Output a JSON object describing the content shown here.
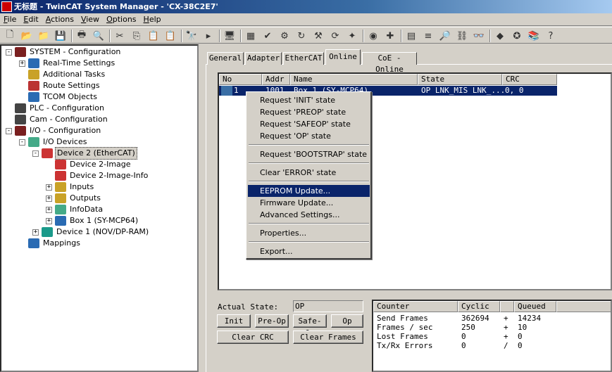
{
  "window": {
    "title": "无标题 - TwinCAT System Manager - 'CX-38C2E7'"
  },
  "menu": [
    "File",
    "Edit",
    "Actions",
    "View",
    "Options",
    "Help"
  ],
  "toolbar_icons": [
    "new-icon",
    "open-icon",
    "open-folder-icon",
    "save-icon",
    "print-icon",
    "print-preview-icon",
    "cut-icon",
    "copy-icon",
    "paste-icon",
    "paste-with-links-icon",
    "find-icon",
    "find-next-icon",
    "monitor-icon",
    "generate-mappings-icon",
    "check-icon",
    "activate-config-icon",
    "restart-run-icon",
    "config-mode-icon",
    "reload-devices-icon",
    "scan-icon",
    "toggle-freerun-icon",
    "show-online-icon",
    "add-icon",
    "variable-list-icon",
    "zoom-icon",
    "online-link-icon",
    "watch-icon",
    "go-icon",
    "force-icon",
    "books-icon",
    "help-icon"
  ],
  "tree": [
    {
      "label": "SYSTEM - Configuration",
      "icon": "system-icon",
      "toggle": "-"
    },
    {
      "label": "Real-Time Settings",
      "icon": "realtime-icon",
      "toggle": "+"
    },
    {
      "label": "Additional Tasks",
      "icon": "tasks-icon",
      "toggle": ""
    },
    {
      "label": "Route Settings",
      "icon": "route-icon",
      "toggle": ""
    },
    {
      "label": "TCOM Objects",
      "icon": "tcom-icon",
      "toggle": ""
    },
    {
      "label": "PLC - Configuration",
      "icon": "plc-icon",
      "toggle": ""
    },
    {
      "label": "Cam - Configuration",
      "icon": "cam-icon",
      "toggle": ""
    },
    {
      "label": "I/O - Configuration",
      "icon": "io-icon",
      "toggle": "-"
    },
    {
      "label": "I/O Devices",
      "icon": "io-devices-icon",
      "toggle": "-"
    },
    {
      "label": "Device 2 (EtherCAT)",
      "icon": "ethercat-device-icon",
      "toggle": "-"
    },
    {
      "label": "Device 2-Image",
      "icon": "image-icon",
      "toggle": ""
    },
    {
      "label": "Device 2-Image-Info",
      "icon": "image-info-icon",
      "toggle": ""
    },
    {
      "label": "Inputs",
      "icon": "inputs-icon",
      "toggle": "+"
    },
    {
      "label": "Outputs",
      "icon": "outputs-icon",
      "toggle": "+"
    },
    {
      "label": "InfoData",
      "icon": "infodata-icon",
      "toggle": "+"
    },
    {
      "label": "Box 1 (SY-MCP64)",
      "icon": "box-icon",
      "toggle": "+"
    },
    {
      "label": "Device 1 (NOV/DP-RAM)",
      "icon": "device-icon",
      "toggle": "+"
    },
    {
      "label": "Mappings",
      "icon": "mappings-icon",
      "toggle": ""
    }
  ],
  "tabs": [
    "General",
    "Adapter",
    "EtherCAT",
    "Online",
    "CoE - Online"
  ],
  "device_list": {
    "headers": [
      "No",
      "Addr",
      "Name",
      "State",
      "CRC"
    ],
    "row": {
      "no": "1",
      "addr": "1001",
      "name": "Box 1 (SY-MCP64)",
      "state": "OP LNK_MIS LNK_...",
      "crc": "0, 0"
    }
  },
  "context_menu": {
    "groups": [
      [
        "Request 'INIT' state",
        "Request 'PREOP' state",
        "Request 'SAFEOP' state",
        "Request 'OP' state"
      ],
      [
        "Request 'BOOTSTRAP' state"
      ],
      [
        "Clear 'ERROR' state"
      ],
      [
        "EEPROM Update...",
        "Firmware Update...",
        "Advanced Settings..."
      ],
      [
        "Properties..."
      ],
      [
        "Export..."
      ]
    ],
    "highlighted": "EEPROM Update..."
  },
  "state_panel": {
    "label": "Actual State:",
    "value": "OP",
    "buttons": [
      "Init",
      "Pre-Op",
      "Safe-Op",
      "Op",
      "Clear CRC",
      "Clear Frames"
    ]
  },
  "counters": {
    "headers": [
      "Counter",
      "Cyclic",
      "",
      "Queued"
    ],
    "rows": [
      {
        "name": "Send Frames",
        "cyclic": "362694",
        "op": "+",
        "queued": "14234"
      },
      {
        "name": "Frames / sec",
        "cyclic": "250",
        "op": "+",
        "queued": "10"
      },
      {
        "name": "Lost Frames",
        "cyclic": "0",
        "op": "+",
        "queued": "0"
      },
      {
        "name": "Tx/Rx Errors",
        "cyclic": "0",
        "op": "/",
        "queued": "0"
      }
    ]
  }
}
